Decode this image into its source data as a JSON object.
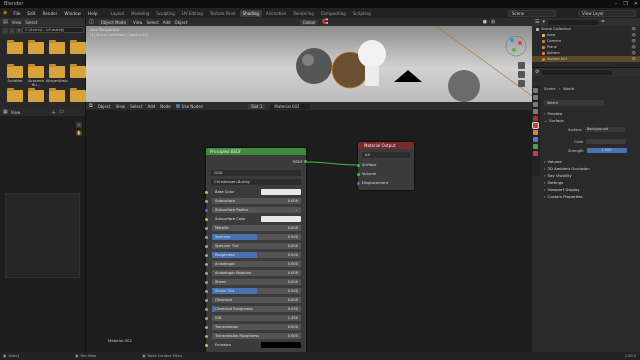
{
  "app": {
    "title": "Blender",
    "win_controls": [
      "–",
      "❐",
      "✕"
    ]
  },
  "menu": {
    "items": [
      "File",
      "Edit",
      "Render",
      "Window",
      "Help"
    ],
    "workspaces": [
      "Layout",
      "Modeling",
      "Sculpting",
      "UV Editing",
      "Texture Paint",
      "Shading",
      "Animation",
      "Rendering",
      "Compositing",
      "Scripting"
    ],
    "active_workspace": "Shading",
    "scene": "Scene",
    "view_layer": "View Layer"
  },
  "file_browser": {
    "header": [
      "View",
      "Select"
    ],
    "path": "C:\\Users\\L...\\ct\\material\\",
    "search": "",
    "folders": [
      "",
      "",
      "",
      "",
      "SolidMat",
      "Airasmsk Bu...",
      "AllegerWmic",
      "",
      "",
      "",
      "",
      ""
    ]
  },
  "viewport": {
    "header": [
      "Object Mode",
      "View",
      "Select",
      "Add",
      "Object"
    ],
    "transform": "Global",
    "info_line1": "User Perspective",
    "info_line2": "(1) Scene Collection | Sphere.001"
  },
  "outliner": {
    "items": [
      {
        "label": "Scene Collection",
        "indent": 0,
        "selected": false,
        "icon_color": "#bbbbbb"
      },
      {
        "label": "Area",
        "indent": 1,
        "selected": false,
        "icon_color": "#e0c050"
      },
      {
        "label": "Camera",
        "indent": 1,
        "selected": false,
        "icon_color": "#e07070"
      },
      {
        "label": "Plane",
        "indent": 1,
        "selected": false,
        "icon_color": "#e08030"
      },
      {
        "label": "Sphere",
        "indent": 1,
        "selected": false,
        "icon_color": "#e08030"
      },
      {
        "label": "Sphere.001",
        "indent": 1,
        "selected": true,
        "icon_color": "#e08030"
      }
    ]
  },
  "properties": {
    "scene_label": "Scene",
    "world_label": "World",
    "world_name": "World",
    "sections": [
      "Preview",
      "Surface"
    ],
    "surface_label": "Surface",
    "surface_value": "Background",
    "color_label": "Color",
    "strength_label": "Strength",
    "strength_value": "1.000",
    "collapsed": [
      "Volume",
      "3D Ambient Occlusion",
      "Ray Visibility",
      "Settings",
      "Viewport Display",
      "Custom Properties"
    ]
  },
  "node_editor": {
    "header": [
      "Object",
      "View",
      "Select",
      "Add",
      "Node",
      "Use Nodes"
    ],
    "slot": "Slot 1",
    "material": "Material.002",
    "material_label": "Material.002"
  },
  "bsdf_node": {
    "title": "Principled BSDF",
    "output": "BSDF",
    "distribution": "GGX",
    "subsurface_method": "Christensen-Burley",
    "inputs": [
      {
        "label": "Base Color",
        "value": "",
        "fill": 0,
        "type": "color",
        "swatch": "#e8e8e8",
        "socket": "#c7c729"
      },
      {
        "label": "Subsurface",
        "value": "0.000",
        "fill": 0,
        "type": "slider",
        "socket": "#a1a1a1"
      },
      {
        "label": "Subsurface Radius",
        "value": "",
        "fill": 0,
        "type": "dropdown",
        "socket": "#6363c7"
      },
      {
        "label": "Subsurface Color",
        "value": "",
        "fill": 0,
        "type": "color",
        "swatch": "#e8e8e8",
        "socket": "#c7c729"
      },
      {
        "label": "Metallic",
        "value": "0.000",
        "fill": 0,
        "type": "slider",
        "socket": "#a1a1a1"
      },
      {
        "label": "Specular",
        "value": "0.500",
        "fill": 0.5,
        "type": "slider",
        "socket": "#a1a1a1"
      },
      {
        "label": "Specular Tint",
        "value": "0.000",
        "fill": 0,
        "type": "slider",
        "socket": "#a1a1a1"
      },
      {
        "label": "Roughness",
        "value": "0.500",
        "fill": 0.5,
        "type": "slider",
        "socket": "#a1a1a1"
      },
      {
        "label": "Anisotropic",
        "value": "0.000",
        "fill": 0,
        "type": "slider",
        "socket": "#a1a1a1"
      },
      {
        "label": "Anisotropic Rotation",
        "value": "0.000",
        "fill": 0,
        "type": "slider",
        "socket": "#a1a1a1"
      },
      {
        "label": "Sheen",
        "value": "0.000",
        "fill": 0,
        "type": "slider",
        "socket": "#a1a1a1"
      },
      {
        "label": "Sheen Tint",
        "value": "0.500",
        "fill": 0.5,
        "type": "slider",
        "socket": "#a1a1a1"
      },
      {
        "label": "Clearcoat",
        "value": "0.000",
        "fill": 0,
        "type": "slider",
        "socket": "#a1a1a1"
      },
      {
        "label": "Clearcoat Roughness",
        "value": "0.030",
        "fill": 0.03,
        "type": "slider",
        "socket": "#a1a1a1"
      },
      {
        "label": "IOR",
        "value": "1.450",
        "fill": 0,
        "type": "slider",
        "socket": "#a1a1a1"
      },
      {
        "label": "Transmission",
        "value": "0.000",
        "fill": 0,
        "type": "slider",
        "socket": "#a1a1a1"
      },
      {
        "label": "Transmission Roughness",
        "value": "0.000",
        "fill": 0,
        "type": "slider",
        "socket": "#a1a1a1"
      },
      {
        "label": "Emission",
        "value": "",
        "fill": 0,
        "type": "color",
        "swatch": "#000000",
        "socket": "#c7c729"
      }
    ]
  },
  "output_node": {
    "title": "Material Output",
    "target": "All",
    "sockets": [
      "Surface",
      "Volume",
      "Displacement"
    ]
  },
  "status_bar": {
    "items": [
      "Select",
      "Pan View",
      "Node Context Menu"
    ],
    "version": "2.90.0"
  },
  "colors": {
    "accent": "#4772b3",
    "bsdf_header": "#3f8a3f",
    "output_header": "#7a2a2a",
    "link": "#3cbf3c"
  }
}
